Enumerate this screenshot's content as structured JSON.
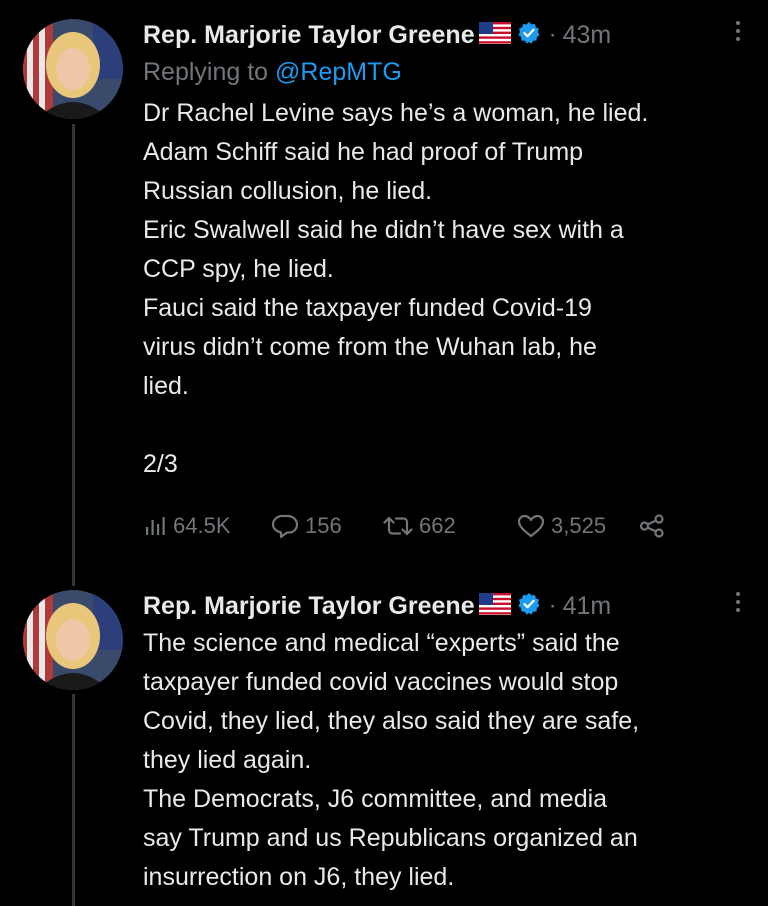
{
  "tweets": [
    {
      "display_name": "Rep. Marjorie Taylor Greene",
      "dot": "·",
      "time": "43m",
      "replying_prefix": "Replying to",
      "replying_handle": "@RepMTG",
      "text": "Dr Rachel Levine says he’s a woman, he lied.\nAdam Schiff said he had proof of Trump\nRussian collusion, he lied.\nEric Swalwell said he didn’t have sex with a\nCCP spy, he lied.\nFauci said the taxpayer funded Covid-19\nvirus didn’t come from the Wuhan lab, he\nlied.\n\n2/3",
      "views": "64.5K",
      "replies": "156",
      "retweets": "662",
      "likes": "3,525"
    },
    {
      "display_name": "Rep. Marjorie Taylor Greene",
      "dot": "·",
      "time": "41m",
      "text": "The science and medical “experts” said the\ntaxpayer funded covid vaccines would stop\nCovid, they lied, they also said they are safe,\nthey lied again.\nThe Democrats, J6 committee, and media\nsay Trump and us Republicans organized an\ninsurrection on J6, they lied."
    }
  ],
  "icons": {
    "flag": "us-flag-icon",
    "verified": "verified-badge-icon",
    "more": "more-options-icon",
    "views": "views-chart-icon",
    "reply": "reply-bubble-icon",
    "retweet": "retweet-icon",
    "like": "heart-icon",
    "share": "share-icon"
  },
  "colors": {
    "background": "#000000",
    "text": "#e7e9ea",
    "muted": "#71767b",
    "accent": "#1d9bf0",
    "thread_line": "#333639"
  }
}
